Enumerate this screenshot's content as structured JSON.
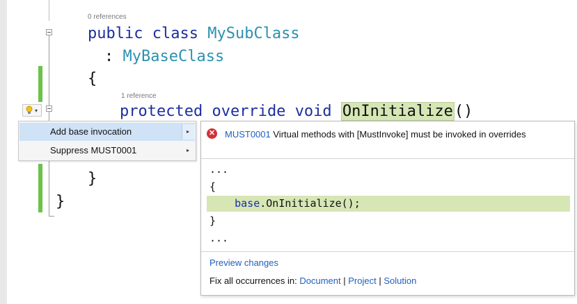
{
  "editor": {
    "ref_class": "0 references",
    "line_class_kw1": "public",
    "line_class_kw2": "class",
    "line_class_name": "MySubClass",
    "line_base_colon": ":",
    "line_base_name": "MyBaseClass",
    "brace_open": "{",
    "ref_method": "1 reference",
    "method_kw1": "protected",
    "method_kw2": "override",
    "method_kw3": "void",
    "method_name": "OnInitialize",
    "method_parens": "()",
    "brace_inner_close": "}",
    "brace_close": "}"
  },
  "lightbulb": {
    "icon": "lightbulb-icon",
    "caret": "▾"
  },
  "menu": {
    "items": [
      {
        "label": "Add base invocation",
        "arrow": "▸"
      },
      {
        "label": "Suppress MUST0001",
        "arrow": "▸"
      }
    ]
  },
  "preview": {
    "error_icon": "✕",
    "diagnostic_id": "MUST0001",
    "diagnostic_message": "Virtual methods with [MustInvoke] must be invoked in overrides",
    "code_lines": [
      "...",
      "{",
      "    base.OnInitialize();",
      "}",
      "..."
    ],
    "preview_changes": "Preview changes",
    "fix_all_label": "Fix all occurrences in:",
    "scope_document": "Document",
    "scope_project": "Project",
    "scope_solution": "Solution",
    "separator": "|"
  },
  "colors": {
    "keyword": "#1b2f9f",
    "type": "#2b91af",
    "link": "#1f5fbf",
    "added_line": "#d6e6b5",
    "change_bar": "#6cc24a",
    "error": "#d03238"
  }
}
